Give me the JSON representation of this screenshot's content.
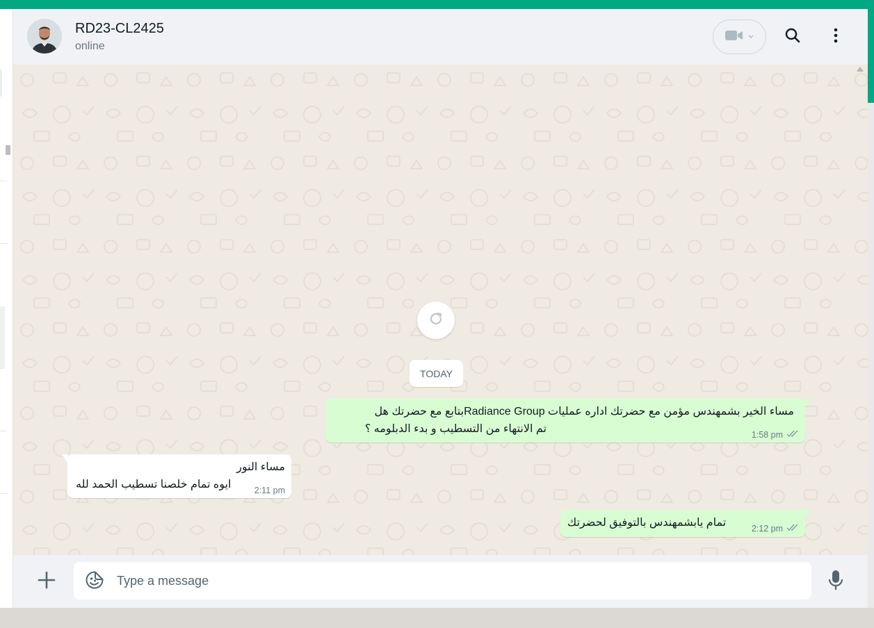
{
  "header": {
    "contact_name": "RD23-CL2425",
    "contact_status": "online"
  },
  "chat": {
    "date_separator": "TODAY",
    "messages": [
      {
        "direction": "outgoing",
        "line1": "مساء الخير بشمهندس مؤمن مع  حضرتك اداره عمليات Radiance Groupبتابع مع حضرتك هل",
        "line2": "تم الانتهاء من التسطيب و بدء الدبلومه ؟",
        "time": "1:58 pm",
        "status": "read"
      },
      {
        "direction": "incoming",
        "line1": "مساء النور",
        "line2": "ايوه تمام خلصنا تسطيب الحمد لله",
        "time": "2:11 pm"
      },
      {
        "direction": "outgoing",
        "line1": "تمام يابشمهندس بالتوفيق لحضرتك",
        "time": "2:12 pm",
        "status": "read"
      }
    ]
  },
  "composer": {
    "placeholder": "Type a message"
  },
  "colors": {
    "accent": "#00a884",
    "outgoing_bubble": "#d9fdd3",
    "incoming_bubble": "#ffffff",
    "chat_background": "#efeae2"
  },
  "icons": {
    "video_call": "video-camera-icon",
    "dropdown": "chevron-down-icon",
    "search": "search-icon",
    "menu": "more-vertical-icon",
    "loader": "refresh-icon",
    "attach": "plus-icon",
    "emoji": "sticker-smiley-icon",
    "voice": "microphone-icon",
    "read_receipt": "double-check-icon"
  }
}
